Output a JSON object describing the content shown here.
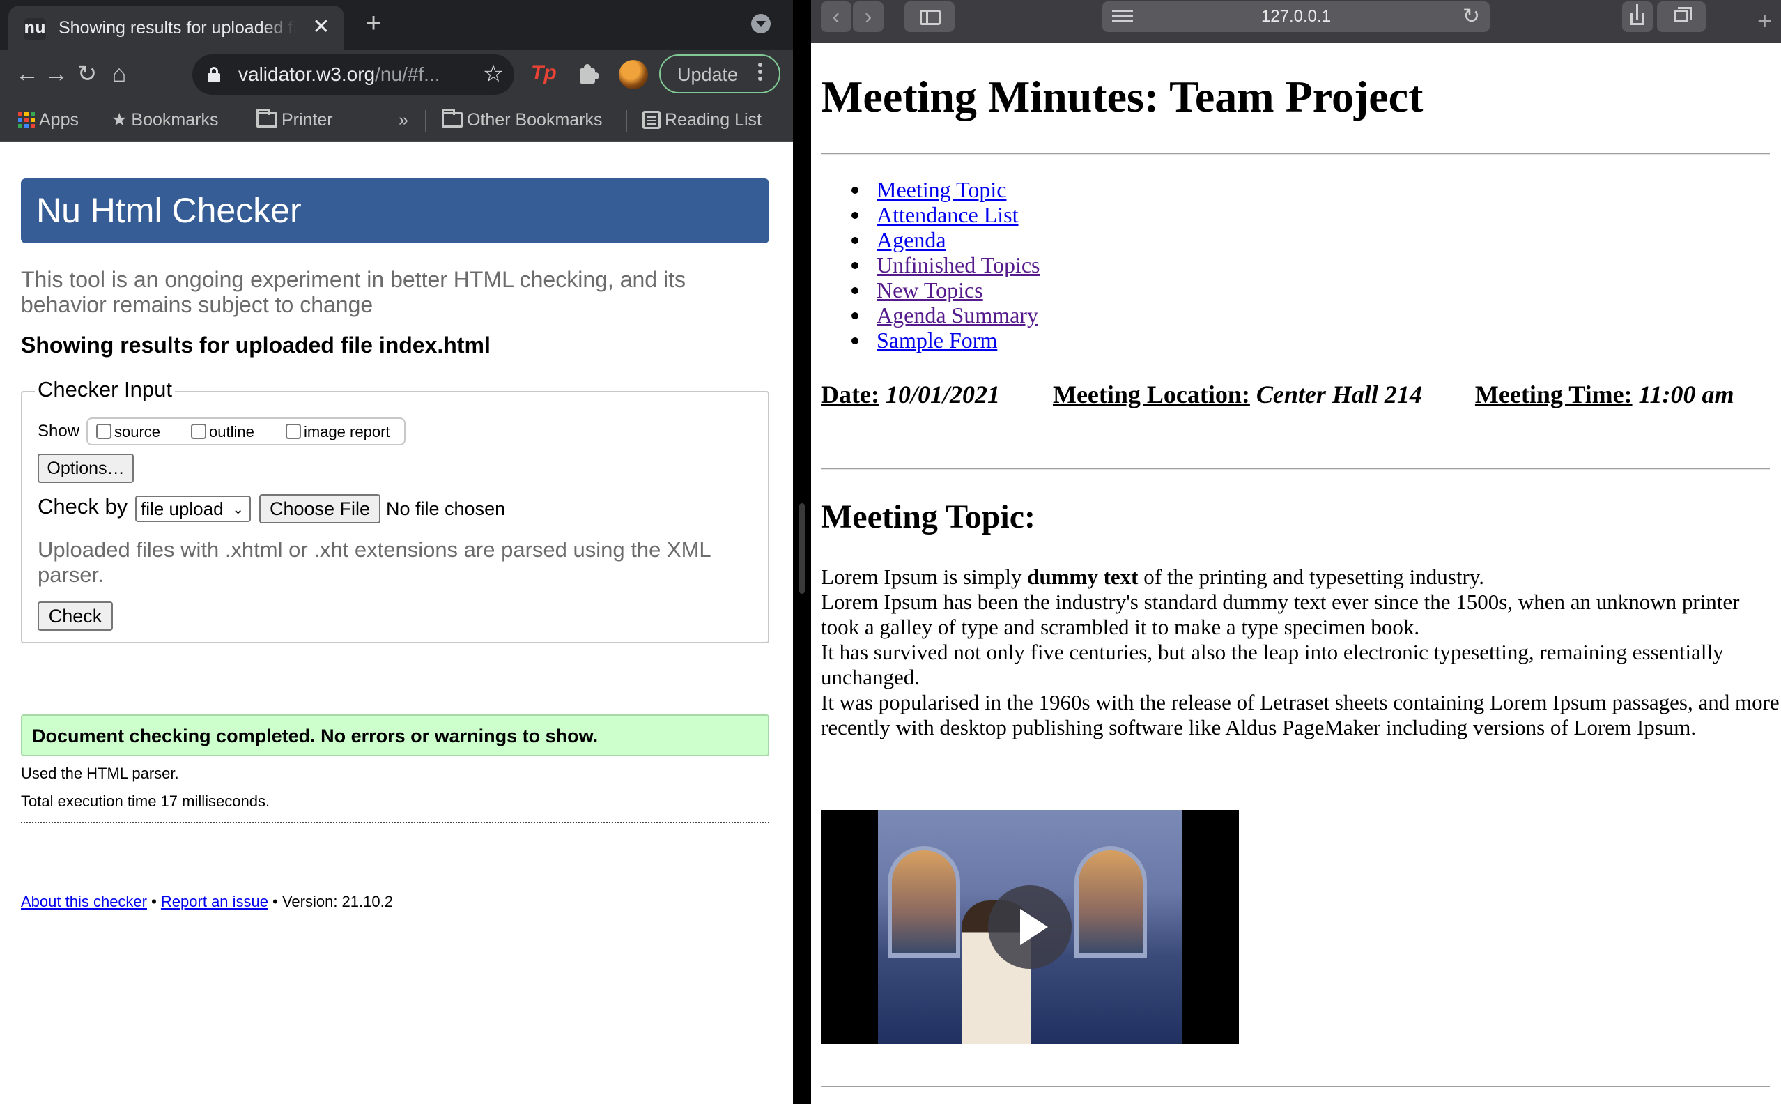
{
  "chrome": {
    "tab": {
      "favicon": "nu",
      "title": "Showing results for uploaded file index.html",
      "close_icon": "✕"
    },
    "new_tab_icon": "+",
    "url": {
      "host": "validator.w3.org",
      "rest": "/nu/#f..."
    },
    "update_label": "Update",
    "extension_label": "Tp",
    "bookmarks": [
      {
        "label": "Apps",
        "icon": "apps-grid-icon"
      },
      {
        "label": "Bookmarks",
        "icon": "star-icon"
      },
      {
        "label": "Printer",
        "icon": "folder-icon"
      },
      {
        "label": "»",
        "icon": ""
      },
      {
        "label": "Other Bookmarks",
        "icon": "folder-icon"
      },
      {
        "label": "Reading List",
        "icon": "reading-list-icon"
      }
    ]
  },
  "checker": {
    "title": "Nu Html Checker",
    "intro": "This tool is an ongoing experiment in better HTML checking, and its behavior remains subject to change",
    "results_heading": "Showing results for uploaded file index.html",
    "input": {
      "legend": "Checker Input",
      "show_label": "Show",
      "checkboxes": [
        "source",
        "outline",
        "image report"
      ],
      "options_label": "Options…",
      "check_by_label": "Check by",
      "check_by_value": "file upload",
      "choose_file_label": "Choose File",
      "no_file": "No file chosen",
      "xml_note": "Uploaded files with .xhtml or .xht extensions are parsed using the XML parser.",
      "check_label": "Check"
    },
    "success_message": "Document checking completed. No errors or warnings to show.",
    "parser_line": "Used the HTML parser.",
    "time_line": "Total execution time 17 milliseconds.",
    "footer": {
      "about": "About this checker",
      "sep": " • ",
      "report": "Report an issue",
      "version": "Version: 21.10.2"
    }
  },
  "safari": {
    "url": "127.0.0.1",
    "plus_icon": "+"
  },
  "minutes": {
    "title": "Meeting Minutes: Team Project",
    "toc": [
      "Meeting Topic",
      "Attendance List",
      "Agenda",
      "Unfinished Topics",
      "New Topics",
      "Agenda Summary",
      "Sample Form"
    ],
    "date_label": "Date:",
    "date_value": "10/01/2021",
    "location_label": "Meeting Location:",
    "location_value": "Center Hall 214",
    "time_label": "Meeting Time:",
    "time_value": "11:00 am",
    "topic_heading": "Meeting Topic:",
    "lorem": {
      "l1_pre": "Lorem Ipsum is simply ",
      "l1_bold": "dummy text",
      "l1_post": " of the printing and typesetting industry.",
      "l2": "Lorem Ipsum has been the industry's standard dummy text ever since the 1500s, when an unknown printer took a galley of type and scrambled it to make a type specimen book.",
      "l3": "It has survived not only five centuries, but also the leap into electronic typesetting, remaining essentially unchanged.",
      "l4": "It was popularised in the 1960s with the release of Letraset sheets containing Lorem Ipsum passages, and more recently with desktop publishing software like Aldus PageMaker including versions of Lorem Ipsum."
    }
  }
}
